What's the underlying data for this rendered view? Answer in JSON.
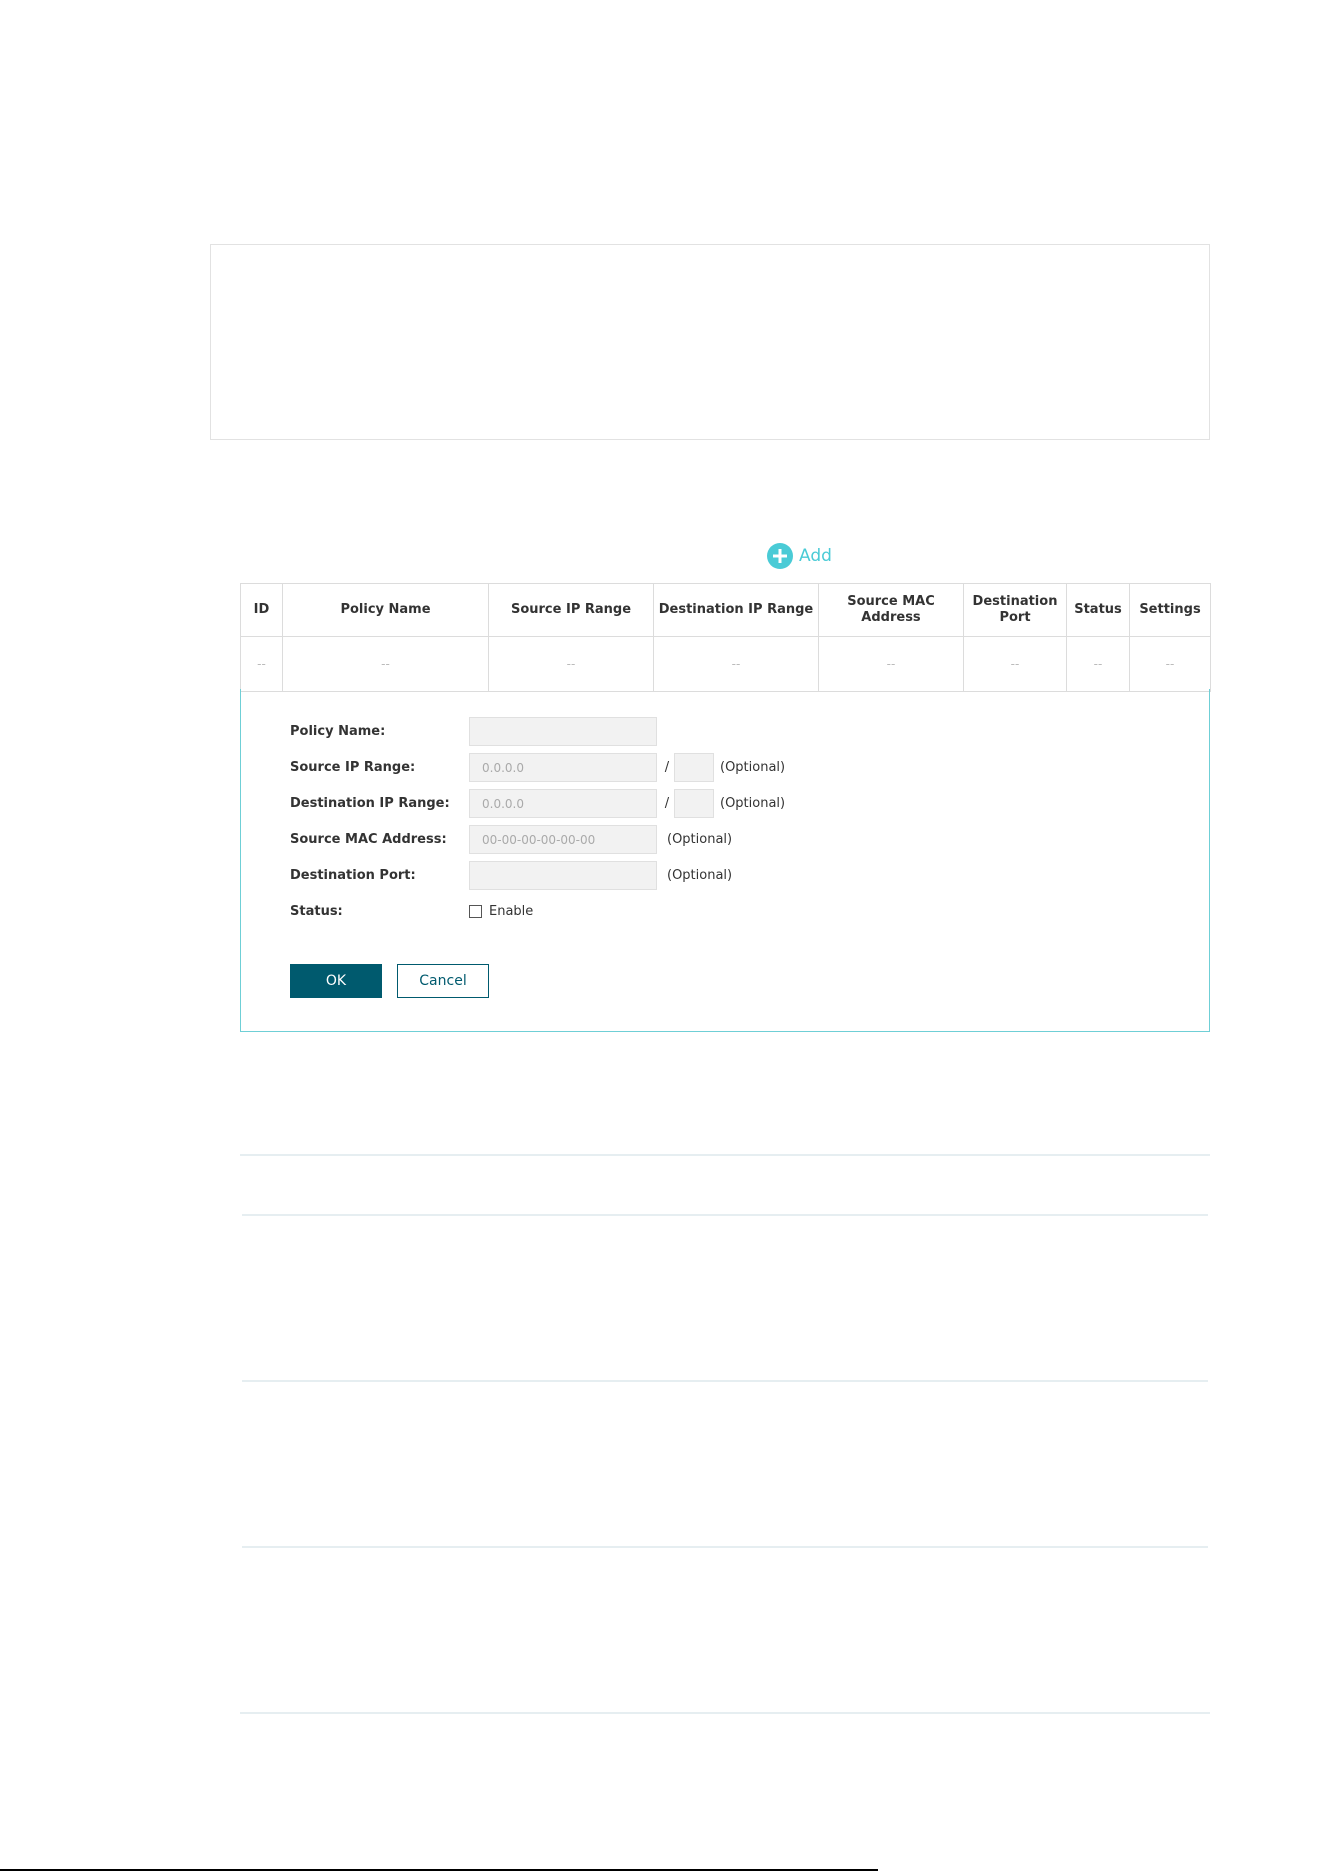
{
  "add_label": "Add",
  "table": {
    "headers": [
      "ID",
      "Policy Name",
      "Source IP Range",
      "Destination IP Range",
      "Source MAC Address",
      "Destination Port",
      "Status",
      "Settings"
    ],
    "empty_row": [
      "--",
      "--",
      "--",
      "--",
      "--",
      "--",
      "--",
      "--"
    ]
  },
  "form": {
    "policy_name_label": "Policy Name:",
    "source_ip_label": "Source IP Range:",
    "source_ip_placeholder": "0.0.0.0",
    "dest_ip_label": "Destination IP Range:",
    "dest_ip_placeholder": "0.0.0.0",
    "source_mac_label": "Source MAC Address:",
    "source_mac_placeholder": "00-00-00-00-00-00",
    "dest_port_label": "Destination Port:",
    "status_label": "Status:",
    "slash": "/",
    "optional": "(Optional)",
    "enable_label": "Enable",
    "ok_label": "OK",
    "cancel_label": "Cancel"
  },
  "colors": {
    "accent": "#4acbd6",
    "primary_button": "#005a6e",
    "panel_border": "#6fcfd6"
  }
}
